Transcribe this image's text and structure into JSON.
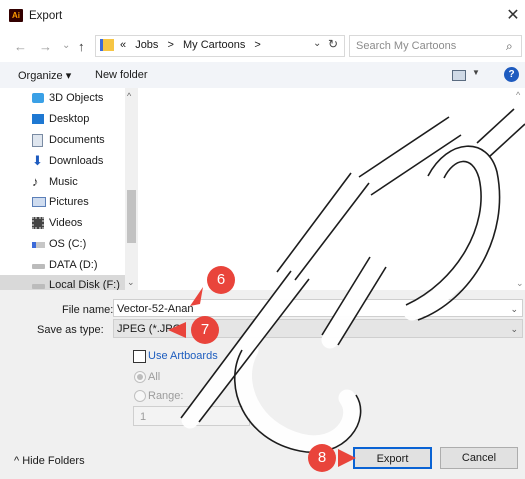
{
  "window": {
    "title": "Export",
    "app_icon_text": "Ai",
    "close_glyph": "✕"
  },
  "nav": {
    "back": "←",
    "forward": "→",
    "recent": "⌄",
    "up": "↑"
  },
  "address": {
    "overflow": "«",
    "crumbs": [
      "Jobs",
      ">",
      "My Cartoons",
      ">"
    ],
    "dropdown": "⌄",
    "refresh": "↻"
  },
  "search": {
    "placeholder": "Search My Cartoons",
    "icon": "⌕"
  },
  "toolbar": {
    "organize": "Organize ▾",
    "new_folder": "New folder",
    "view_down": "▼",
    "help": "?"
  },
  "sidebar": {
    "items": [
      {
        "label": "3D Objects",
        "icon": "cube-icon",
        "color": "#3aa0e6"
      },
      {
        "label": "Desktop",
        "icon": "desktop-icon",
        "color": "#1e78d2"
      },
      {
        "label": "Documents",
        "icon": "documents-icon",
        "color": "#7a8ba3"
      },
      {
        "label": "Downloads",
        "icon": "download-icon",
        "color": "#1e5bbf"
      },
      {
        "label": "Music",
        "icon": "music-icon",
        "color": "#333333"
      },
      {
        "label": "Pictures",
        "icon": "pictures-icon",
        "color": "#5b7fb8"
      },
      {
        "label": "Videos",
        "icon": "videos-icon",
        "color": "#444444"
      },
      {
        "label": "OS (C:)",
        "icon": "drive-os-icon",
        "color": "#3d6bd9"
      },
      {
        "label": "DATA (D:)",
        "icon": "drive-icon",
        "color": "#777777"
      },
      {
        "label": "Local Disk (F:)",
        "icon": "drive-icon",
        "color": "#777777"
      }
    ]
  },
  "scroll": {
    "up": "^",
    "down": "⌄"
  },
  "form": {
    "filename_label": "File name:",
    "filename_value": "Vector-52-Anan",
    "savetype_label": "Save as type:",
    "savetype_value": "JPEG (*.JPG)",
    "dropdown": "⌄",
    "use_artboards": "Use Artboards",
    "all": "All",
    "range": "Range:",
    "range_value": "1"
  },
  "footer": {
    "hide_folders": "^  Hide Folders",
    "export": "Export",
    "cancel": "Cancel"
  },
  "callouts": {
    "six": "6",
    "seven": "7",
    "eight": "8"
  },
  "colors": {
    "accent": "#0a63d4",
    "callout": "#e9443b",
    "link": "#1d5dbf"
  }
}
